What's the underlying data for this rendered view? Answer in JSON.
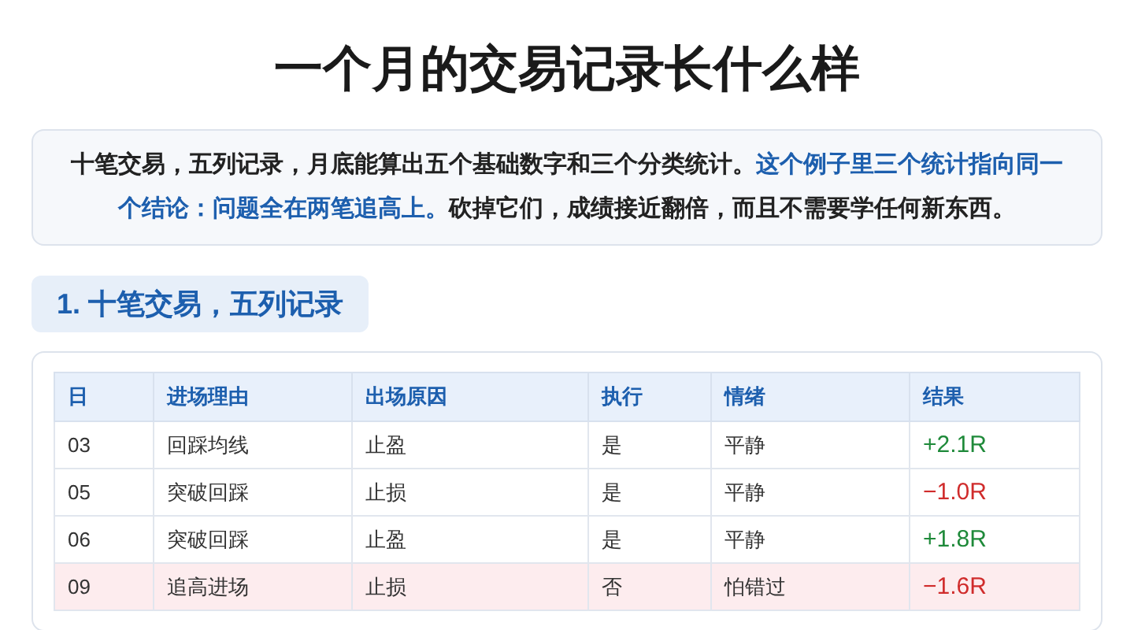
{
  "title": "一个月的交易记录长什么样",
  "intro": {
    "text": "十笔交易，五列记录，月底能算出五个基础数字和三个分类统计。",
    "highlight": "这个例子里三个统计指向同一个结论：问题全在两笔追高上。",
    "tail": "砍掉它们，成绩接近翻倍，而且不需要学任何新东西。"
  },
  "section": {
    "heading": "1. 十笔交易，五列记录"
  },
  "table": {
    "columns": [
      "日",
      "进场理由",
      "出场原因",
      "执行",
      "情绪",
      "结果"
    ],
    "rows": [
      {
        "cells": [
          "03",
          "回踩均线",
          "止盈",
          "是",
          "平静",
          "+2.1R"
        ],
        "color": "#1f8a3a",
        "highlighted": false
      },
      {
        "cells": [
          "05",
          "突破回踩",
          "止损",
          "是",
          "平静",
          "−1.0R"
        ],
        "color": "#d02c2c",
        "highlighted": false
      },
      {
        "cells": [
          "06",
          "突破回踩",
          "止盈",
          "是",
          "平静",
          "+1.8R"
        ],
        "color": "#1f8a3a",
        "highlighted": false
      },
      {
        "cells": [
          "09",
          "追高进场",
          "止损",
          "否",
          "怕错过",
          "−1.6R"
        ],
        "color": "#d02c2c",
        "highlighted": true
      }
    ]
  }
}
